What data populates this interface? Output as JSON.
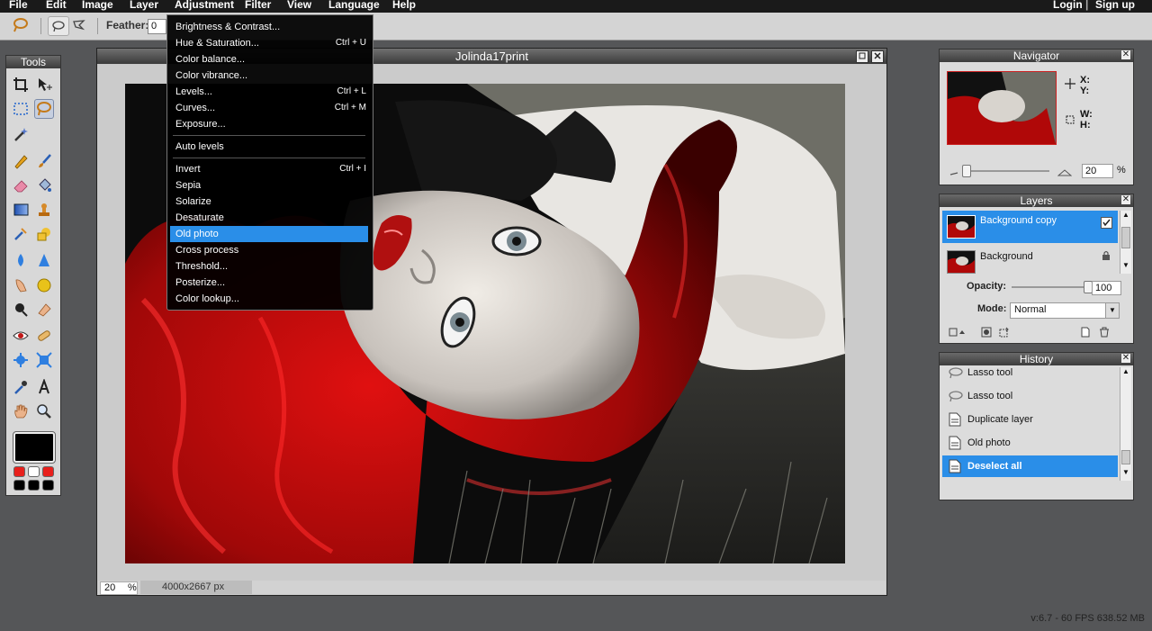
{
  "menubar": {
    "items": [
      "File",
      "Edit",
      "Image",
      "Layer",
      "Adjustment",
      "Filter",
      "View",
      "Language",
      "Help"
    ],
    "login": "Login",
    "separator": "|",
    "signup": "Sign up"
  },
  "options": {
    "feather_label": "Feather:",
    "feather_value": "0"
  },
  "tools": {
    "title": "Tools",
    "selected": "lasso-tool",
    "foreground_color": "#000000",
    "swatches": [
      "#e8201c",
      "#ffffff",
      "#e8201c",
      "#000000",
      "#000000",
      "#000000"
    ]
  },
  "document": {
    "title": "Jolinda17print",
    "zoom": "20",
    "zoom_unit": "%",
    "dimensions": "4000x2667 px"
  },
  "adjustment_menu": {
    "items": [
      {
        "label": "Brightness & Contrast...",
        "shortcut": ""
      },
      {
        "label": "Hue & Saturation...",
        "shortcut": "Ctrl + U"
      },
      {
        "label": "Color balance...",
        "shortcut": ""
      },
      {
        "label": "Color vibrance...",
        "shortcut": ""
      },
      {
        "label": "Levels...",
        "shortcut": "Ctrl + L"
      },
      {
        "label": "Curves...",
        "shortcut": "Ctrl + M"
      },
      {
        "label": "Exposure...",
        "shortcut": ""
      },
      {
        "label": "Auto levels",
        "shortcut": ""
      },
      {
        "label": "Invert",
        "shortcut": "Ctrl + I"
      },
      {
        "label": "Sepia",
        "shortcut": ""
      },
      {
        "label": "Solarize",
        "shortcut": ""
      },
      {
        "label": "Desaturate",
        "shortcut": ""
      },
      {
        "label": "Old photo",
        "shortcut": ""
      },
      {
        "label": "Cross process",
        "shortcut": ""
      },
      {
        "label": "Threshold...",
        "shortcut": ""
      },
      {
        "label": "Posterize...",
        "shortcut": ""
      },
      {
        "label": "Color lookup...",
        "shortcut": ""
      }
    ],
    "highlighted": "Old photo",
    "highlight_color": "#2a8ee8"
  },
  "navigator": {
    "title": "Navigator",
    "x_label": "X:",
    "y_label": "Y:",
    "w_label": "W:",
    "h_label": "H:",
    "zoom": "20",
    "zoom_unit": "%"
  },
  "layers": {
    "title": "Layers",
    "items": [
      {
        "name": "Background copy",
        "visible": true,
        "selected": true
      },
      {
        "name": "Background",
        "locked": true,
        "selected": false
      }
    ],
    "opacity_label": "Opacity:",
    "opacity_value": "100",
    "mode_label": "Mode:",
    "mode_value": "Normal"
  },
  "history": {
    "title": "History",
    "items": [
      {
        "label": "Lasso tool",
        "icon": "lasso-icon"
      },
      {
        "label": "Lasso tool",
        "icon": "lasso-icon"
      },
      {
        "label": "Duplicate layer",
        "icon": "document-icon"
      },
      {
        "label": "Old photo",
        "icon": "document-icon"
      },
      {
        "label": "Deselect all",
        "icon": "document-icon",
        "selected": true
      }
    ]
  },
  "status": {
    "version_info": "v:6.7 - 60 FPS 638.52 MB"
  }
}
